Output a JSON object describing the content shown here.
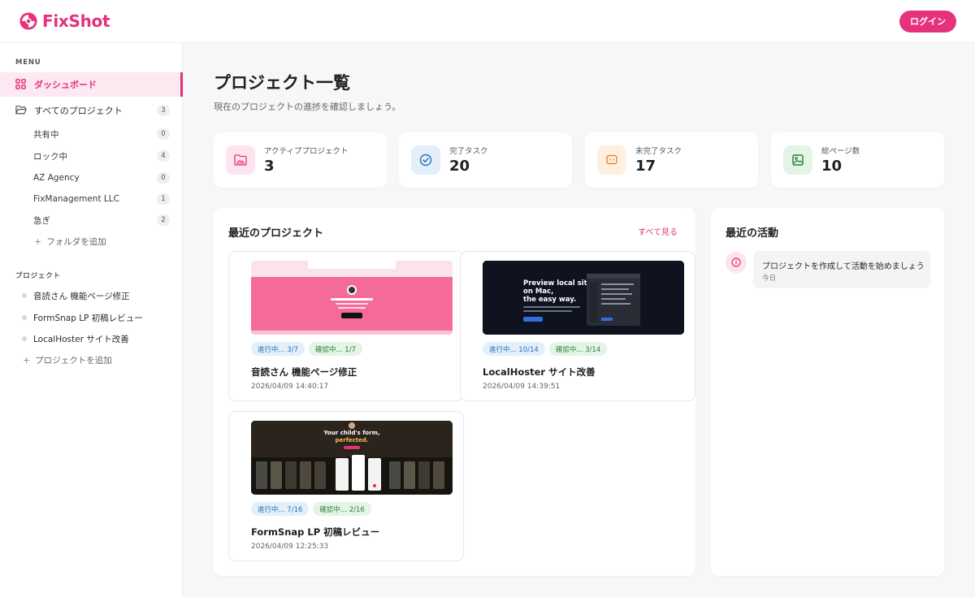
{
  "app": {
    "name": "FixShot"
  },
  "header": {
    "login_label": "ログイン"
  },
  "sidebar": {
    "menu_label": "MENU",
    "dashboard_label": "ダッシュボード",
    "all_projects": {
      "label": "すべてのプロジェクト",
      "count": "3"
    },
    "folders": [
      {
        "label": "共有中",
        "count": "0"
      },
      {
        "label": "ロック中",
        "count": "4"
      },
      {
        "label": "AZ Agency",
        "count": "0"
      },
      {
        "label": "FixManagement LLC",
        "count": "1"
      },
      {
        "label": "急ぎ",
        "count": "2"
      }
    ],
    "add_folder_label": "フォルダを追加",
    "projects_label": "プロジェクト",
    "projects": [
      {
        "label": "音読さん 機能ページ修正"
      },
      {
        "label": "FormSnap LP 初稿レビュー"
      },
      {
        "label": "LocalHoster サイト改善"
      }
    ],
    "add_project_label": "プロジェクトを追加"
  },
  "main": {
    "title": "プロジェクト一覧",
    "subtitle": "現在のプロジェクトの進捗を確認しましょう。",
    "stats": [
      {
        "label": "アクティブプロジェクト",
        "value": "3",
        "icon": "folder-image-icon",
        "color": "#fde4ee",
        "accent": "#e6317e"
      },
      {
        "label": "完了タスク",
        "value": "20",
        "icon": "check-circle-icon",
        "color": "#e3f0fc",
        "accent": "#2a6fb6"
      },
      {
        "label": "未完了タスク",
        "value": "17",
        "icon": "chat-icon",
        "color": "#fdf0e1",
        "accent": "#e58a2a"
      },
      {
        "label": "総ページ数",
        "value": "10",
        "icon": "image-icon",
        "color": "#e4f4e6",
        "accent": "#2e7d3a"
      }
    ],
    "recent_projects": {
      "title": "最近のプロジェクト",
      "see_all_label": "すべて見る",
      "cards": [
        {
          "name": "音読さん 機能ページ修正",
          "date": "2026/04/09 14:40:17",
          "tag_progress": "進行中... 3/7",
          "tag_review": "確認中... 1/7"
        },
        {
          "name": "LocalHoster サイト改善",
          "date": "2026/04/09 14:39:51",
          "tag_progress": "進行中... 10/14",
          "tag_review": "確認中... 3/14"
        },
        {
          "name": "FormSnap LP 初稿レビュー",
          "date": "2026/04/09 12:25:33",
          "tag_progress": "進行中... 7/16",
          "tag_review": "確認中... 2/16"
        }
      ]
    },
    "activity": {
      "title": "最近の活動",
      "items": [
        {
          "text": "プロジェクトを作成して活動を始めましょう",
          "date": "今日"
        }
      ]
    }
  },
  "thumbnails": {
    "localhoster": {
      "headline_1": "Preview local sites",
      "headline_2": "on Mac,",
      "headline_3": "the easy way."
    },
    "formsnap": {
      "headline_1": "Your child's form,",
      "headline_2": "perfected."
    }
  },
  "colors": {
    "accent": "#e6317e",
    "sidebar_active_bg": "#fde9f1"
  }
}
